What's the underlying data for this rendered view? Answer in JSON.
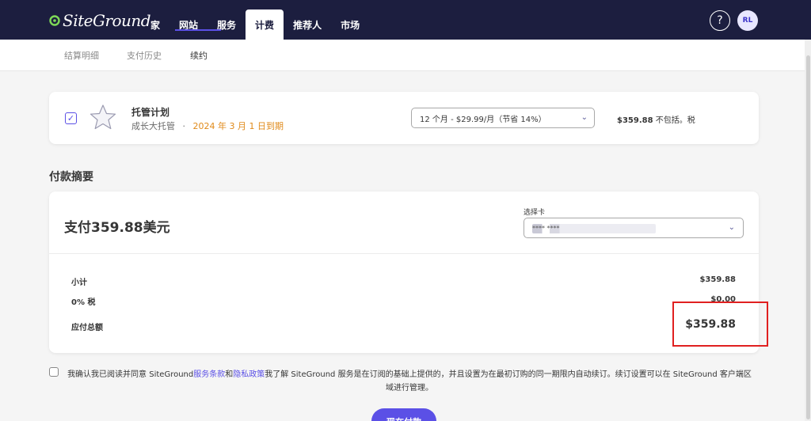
{
  "brand": {
    "logo_text": "SiteGround",
    "accent": "#5b50e6",
    "nav_bg": "#1c1e3f"
  },
  "nav": {
    "items": [
      {
        "label": "家"
      },
      {
        "label": "网站"
      },
      {
        "label": "服务"
      },
      {
        "label": "计费",
        "active": true
      },
      {
        "label": "推荐人"
      },
      {
        "label": "市场"
      }
    ],
    "help_label": "?",
    "avatar_initials": "RL"
  },
  "subnav": {
    "tabs": [
      {
        "label": "结算明细"
      },
      {
        "label": "支付历史"
      },
      {
        "label": "续约",
        "active": true
      }
    ]
  },
  "plan": {
    "title": "托管计划",
    "subtitle": "成长大托管",
    "separator": "·",
    "due": "2024 年 3 月 1 日到期",
    "period_option": "12 个月 - $29.99/月（节省 14%）",
    "price": "$359.88",
    "price_suffix": "不包括。税",
    "checked": true
  },
  "summary": {
    "heading": "付款摘要",
    "pay_title": "支付359.88美元",
    "card_label": "选择卡",
    "card_value": "****  ****",
    "rows": [
      {
        "label": "小计",
        "value": "$359.88"
      },
      {
        "label": "0% 税",
        "value": "$0.00"
      }
    ],
    "total_label": "应付总额",
    "total_value": "$359.88"
  },
  "terms": {
    "prefix": "我确认我已阅读并同意 SiteGround",
    "tos_link": "服务条款",
    "and": "和",
    "privacy_link": "隐私政策",
    "suffix": "我了解 SiteGround 服务是在订阅的基础上提供的，并且设置为在最初订购的同一期限内自动续订。续订设置可以在 SiteGround 客户端区域进行管理。"
  },
  "pay_button": {
    "label": "现在付款"
  }
}
